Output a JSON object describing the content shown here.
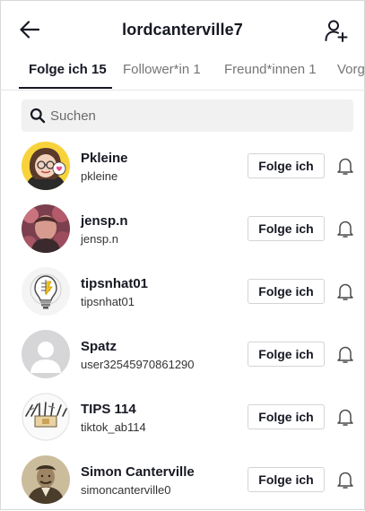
{
  "header": {
    "title": "lordcanterville7",
    "back_icon": "arrow-left-icon",
    "add_icon": "add-user-icon"
  },
  "tabs": [
    {
      "label": "Folge ich 15",
      "active": true
    },
    {
      "label": "Follower*in 1",
      "active": false
    },
    {
      "label": "Freund*innen 1",
      "active": false
    },
    {
      "label": "Vorg",
      "active": false
    }
  ],
  "search": {
    "placeholder": "Suchen",
    "value": ""
  },
  "users": [
    {
      "name": "Pkleine",
      "handle": "pkleine",
      "button_label": "Folge ich",
      "avatar": "illustrated-woman"
    },
    {
      "name": "jensp.n",
      "handle": "jensp.n",
      "button_label": "Folge ich",
      "avatar": "photo-person-flowers"
    },
    {
      "name": "tipsnhat01",
      "handle": "tipsnhat01",
      "button_label": "Folge ich",
      "avatar": "lightbulb"
    },
    {
      "name": "Spatz",
      "handle": "user32545970861290",
      "button_label": "Folge ich",
      "avatar": "default-silhouette"
    },
    {
      "name": "TIPS 114",
      "handle": "tiktok_ab114",
      "button_label": "Folge ich",
      "avatar": "tools-sketch"
    },
    {
      "name": "Simon Canterville",
      "handle": "simoncanterville0",
      "button_label": "Folge ich",
      "avatar": "vintage-portrait"
    }
  ],
  "colors": {
    "text": "#161823",
    "muted": "#757575",
    "search_bg": "#f1f1f2",
    "border": "#d4d4d4"
  }
}
